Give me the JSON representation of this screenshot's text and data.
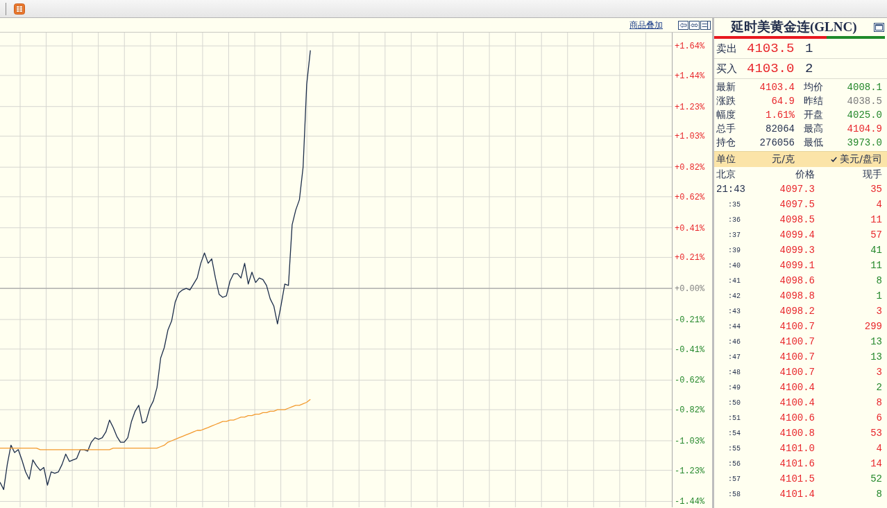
{
  "chart": {
    "overlay_link": "商品叠加",
    "chart_data": [
      {
        "type": "line",
        "ylim": [
          -1.48,
          1.73
        ],
        "tick_labels": "y",
        "grid": true,
        "yticks": [
          {
            "value": 1.64,
            "label": "+1.64%"
          },
          {
            "value": 1.44,
            "label": "+1.44%"
          },
          {
            "value": 1.23,
            "label": "+1.23%"
          },
          {
            "value": 1.03,
            "label": "+1.03%"
          },
          {
            "value": 0.82,
            "label": "+0.82%"
          },
          {
            "value": 0.62,
            "label": "+0.62%"
          },
          {
            "value": 0.41,
            "label": "+0.41%"
          },
          {
            "value": 0.21,
            "label": "+0.21%"
          },
          {
            "value": 0,
            "label": "+0.00%"
          },
          {
            "value": -0.21,
            "label": "-0.21%"
          },
          {
            "value": -0.41,
            "label": "-0.41%"
          },
          {
            "value": -0.62,
            "label": "-0.62%"
          },
          {
            "value": -0.82,
            "label": "-0.82%"
          },
          {
            "value": -1.03,
            "label": "-1.03%"
          },
          {
            "value": -1.23,
            "label": "-1.23%"
          },
          {
            "value": -1.44,
            "label": "-1.44%"
          }
        ],
        "ref_lines": [
          {
            "axis": "y",
            "value": 0,
            "color": "#a6a6a6"
          }
        ],
        "series": [
          {
            "color": "#1c2d4a",
            "values": [
              -1.31,
              -1.36,
              -1.19,
              -1.06,
              -1.11,
              -1.09,
              -1.16,
              -1.24,
              -1.29,
              -1.16,
              -1.2,
              -1.23,
              -1.21,
              -1.33,
              -1.24,
              -1.25,
              -1.24,
              -1.19,
              -1.12,
              -1.17,
              -1.16,
              -1.15,
              -1.09,
              -1.09,
              -1.1,
              -1.04,
              -1.01,
              -1.02,
              -1.01,
              -0.97,
              -0.89,
              -0.94,
              -1.0,
              -1.04,
              -1.04,
              -1.01,
              -0.9,
              -0.83,
              -0.79,
              -0.91,
              -0.9,
              -0.81,
              -0.76,
              -0.67,
              -0.47,
              -0.4,
              -0.28,
              -0.22,
              -0.09,
              -0.03,
              -0.01,
              0.0,
              -0.01,
              0.03,
              0.07,
              0.17,
              0.24,
              0.17,
              0.2,
              0.07,
              -0.04,
              -0.06,
              -0.05,
              0.05,
              0.1,
              0.1,
              0.07,
              0.17,
              0.03,
              0.11,
              0.04,
              0.07,
              0.06,
              0.02,
              -0.07,
              -0.12,
              -0.24,
              -0.11,
              0.03,
              0.02,
              0.43,
              0.53,
              0.6,
              0.82,
              1.38,
              1.61,
              null,
              null,
              null,
              null,
              null,
              null,
              null,
              null,
              null,
              null,
              null,
              null,
              null,
              null,
              null,
              null,
              null,
              null,
              null,
              null,
              null,
              null,
              null,
              null,
              null,
              null,
              null,
              null,
              null,
              null,
              null,
              null,
              null,
              null,
              null,
              null,
              null,
              null,
              null,
              null,
              null,
              null,
              null,
              null,
              null,
              null,
              null,
              null,
              null,
              null,
              null,
              null,
              null,
              null,
              null,
              null,
              null,
              null,
              null,
              null,
              null,
              null,
              null,
              null,
              null,
              null,
              null,
              null,
              null,
              null,
              null,
              null,
              null,
              null,
              null,
              null,
              null,
              null,
              null,
              null,
              null,
              null,
              null,
              null,
              null,
              null,
              null,
              null,
              null,
              null,
              null,
              null,
              null,
              null,
              null,
              null,
              null,
              null,
              null
            ]
          },
          {
            "color": "#f39a2e",
            "values": [
              -1.08,
              -1.08,
              -1.08,
              -1.08,
              -1.08,
              -1.08,
              -1.08,
              -1.08,
              -1.08,
              -1.08,
              -1.08,
              -1.09,
              -1.09,
              -1.09,
              -1.09,
              -1.09,
              -1.09,
              -1.09,
              -1.09,
              -1.09,
              -1.09,
              -1.09,
              -1.09,
              -1.09,
              -1.09,
              -1.09,
              -1.09,
              -1.09,
              -1.09,
              -1.09,
              -1.09,
              -1.08,
              -1.08,
              -1.08,
              -1.08,
              -1.08,
              -1.08,
              -1.08,
              -1.08,
              -1.08,
              -1.08,
              -1.08,
              -1.08,
              -1.08,
              -1.07,
              -1.06,
              -1.04,
              -1.03,
              -1.02,
              -1.01,
              -1.0,
              -0.99,
              -0.98,
              -0.97,
              -0.96,
              -0.96,
              -0.95,
              -0.94,
              -0.93,
              -0.92,
              -0.91,
              -0.9,
              -0.9,
              -0.89,
              -0.89,
              -0.88,
              -0.87,
              -0.87,
              -0.86,
              -0.86,
              -0.85,
              -0.85,
              -0.84,
              -0.84,
              -0.83,
              -0.83,
              -0.82,
              -0.82,
              -0.82,
              -0.81,
              -0.8,
              -0.79,
              -0.79,
              -0.78,
              -0.77,
              -0.75,
              null,
              null,
              null,
              null,
              null,
              null,
              null,
              null,
              null,
              null,
              null,
              null,
              null,
              null,
              null,
              null,
              null,
              null,
              null,
              null,
              null,
              null,
              null,
              null,
              null,
              null,
              null,
              null,
              null,
              null,
              null,
              null,
              null,
              null,
              null,
              null,
              null,
              null,
              null,
              null,
              null,
              null,
              null,
              null,
              null,
              null,
              null,
              null,
              null,
              null,
              null,
              null,
              null,
              null,
              null,
              null,
              null,
              null,
              null,
              null,
              null,
              null,
              null,
              null,
              null,
              null,
              null,
              null,
              null,
              null,
              null,
              null,
              null,
              null,
              null,
              null,
              null,
              null,
              null,
              null,
              null,
              null,
              null,
              null,
              null,
              null,
              null,
              null,
              null,
              null,
              null,
              null,
              null,
              null,
              null,
              null,
              null,
              null,
              null
            ]
          }
        ]
      }
    ]
  },
  "quote": {
    "title": "延时美黄金连(GLNC)",
    "ratio_bar": {
      "level": 0.66
    },
    "order_book": [
      {
        "label": "卖出",
        "price": "4103.5",
        "volume": "1"
      },
      {
        "label": "买入",
        "price": "4103.0",
        "volume": "2"
      }
    ],
    "stats": [
      {
        "label": "最新",
        "value": "4103.4",
        "color": "#e8262b"
      },
      {
        "label": "均价",
        "value": "4008.1",
        "color": "#23872a"
      },
      {
        "label": "涨跌",
        "value": "64.9",
        "color": "#e8262b"
      },
      {
        "label": "昨结",
        "value": "4038.5",
        "color": "#7a7a7a"
      },
      {
        "label": "幅度",
        "value": "1.61%",
        "color": "#e8262b"
      },
      {
        "label": "开盘",
        "value": "4025.0",
        "color": "#23872a"
      },
      {
        "label": "总手",
        "value": "82064",
        "color": "#24304f"
      },
      {
        "label": "最高",
        "value": "4104.9",
        "color": "#e8262b"
      },
      {
        "label": "持仓",
        "value": "276056",
        "color": "#24304f"
      },
      {
        "label": "最低",
        "value": "3973.0",
        "color": "#23872a"
      }
    ],
    "unit": {
      "label": "单位",
      "options": [
        {
          "label": "元/克",
          "selected": false
        },
        {
          "label": "美元/盘司",
          "selected": true
        }
      ]
    }
  },
  "ticks": {
    "columns": [
      "北京",
      "价格",
      "现手"
    ],
    "rows": [
      {
        "kind": "full",
        "time": "21:43",
        "price": "4097.3",
        "volume": "35",
        "color": "#e8262b"
      },
      {
        "kind": "minute",
        "time": ":35",
        "price": "4097.5",
        "volume": "4",
        "color": "#e8262b"
      },
      {
        "kind": "minute",
        "time": ":36",
        "price": "4098.5",
        "volume": "11",
        "color": "#e8262b"
      },
      {
        "kind": "minute",
        "time": ":37",
        "price": "4099.4",
        "volume": "57",
        "color": "#e8262b"
      },
      {
        "kind": "minute",
        "time": ":39",
        "price": "4099.3",
        "volume": "41",
        "color": "#23872a"
      },
      {
        "kind": "minute",
        "time": ":40",
        "price": "4099.1",
        "volume": "11",
        "color": "#23872a"
      },
      {
        "kind": "minute",
        "time": ":41",
        "price": "4098.6",
        "volume": "8",
        "color": "#23872a"
      },
      {
        "kind": "minute",
        "time": ":42",
        "price": "4098.8",
        "volume": "1",
        "color": "#23872a"
      },
      {
        "kind": "minute",
        "time": ":43",
        "price": "4098.2",
        "volume": "3",
        "color": "#e8262b"
      },
      {
        "kind": "minute",
        "time": ":44",
        "price": "4100.7",
        "volume": "299",
        "color": "#e8262b"
      },
      {
        "kind": "minute",
        "time": ":46",
        "price": "4100.7",
        "volume": "13",
        "color": "#23872a"
      },
      {
        "kind": "minute",
        "time": ":47",
        "price": "4100.7",
        "volume": "13",
        "color": "#23872a"
      },
      {
        "kind": "minute",
        "time": ":48",
        "price": "4100.7",
        "volume": "3",
        "color": "#e8262b"
      },
      {
        "kind": "minute",
        "time": ":49",
        "price": "4100.4",
        "volume": "2",
        "color": "#23872a"
      },
      {
        "kind": "minute",
        "time": ":50",
        "price": "4100.4",
        "volume": "8",
        "color": "#e8262b"
      },
      {
        "kind": "minute",
        "time": ":51",
        "price": "4100.6",
        "volume": "6",
        "color": "#e8262b"
      },
      {
        "kind": "minute",
        "time": ":54",
        "price": "4100.8",
        "volume": "53",
        "color": "#e8262b"
      },
      {
        "kind": "minute",
        "time": ":55",
        "price": "4101.0",
        "volume": "4",
        "color": "#e8262b"
      },
      {
        "kind": "minute",
        "time": ":56",
        "price": "4101.6",
        "volume": "14",
        "color": "#e8262b"
      },
      {
        "kind": "minute",
        "time": ":57",
        "price": "4101.5",
        "volume": "52",
        "color": "#23872a"
      },
      {
        "kind": "minute",
        "time": ":58",
        "price": "4101.4",
        "volume": "8",
        "color": "#23872a"
      }
    ]
  }
}
